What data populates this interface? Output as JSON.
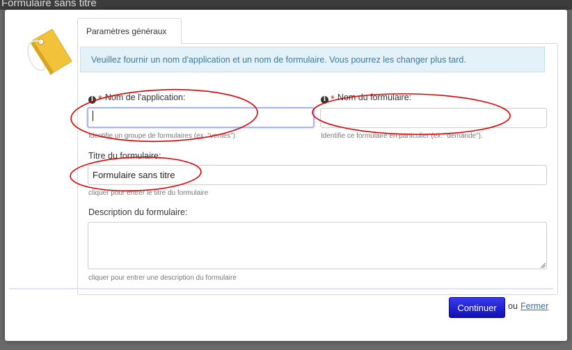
{
  "window": {
    "title": "Formulaire sans titre"
  },
  "tab": {
    "label": "Paramètres généraux"
  },
  "alert": {
    "text": "Veuillez fournir un nom d'application et un nom de formulaire. Vous pourrez les changer plus tard."
  },
  "fields": {
    "app_name": {
      "required_mark": "*",
      "label": "Nom de l'application:",
      "value": "",
      "hint": "Identifie un groupe de formulaires (ex. \"ventes\")"
    },
    "form_name": {
      "required_mark": "*",
      "label": "Nom du formulaire:",
      "value": "",
      "hint": "Identifie ce formulaire en particulier (ex. \"demande\")."
    },
    "form_title": {
      "label": "Titre du formulaire:",
      "value": "Formulaire sans titre",
      "hint": "cliquer pour entrer le titre du formulaire"
    },
    "form_description": {
      "label": "Description du formulaire:",
      "value": "",
      "hint": "cliquer pour entrer une description du formulaire"
    }
  },
  "icons": {
    "info": "info-circle-icon",
    "logo": "tag-icon"
  },
  "footer": {
    "continue_label": "Continuer",
    "or_text": "ou",
    "close_label": "Fermer"
  },
  "colors": {
    "accent": "#1a1ad0",
    "alert_bg": "#e3f1f9",
    "alert_text": "#3a7ba4",
    "required": "#c9302c",
    "annotation": "#dd0000",
    "logo": "#f2c23a"
  }
}
